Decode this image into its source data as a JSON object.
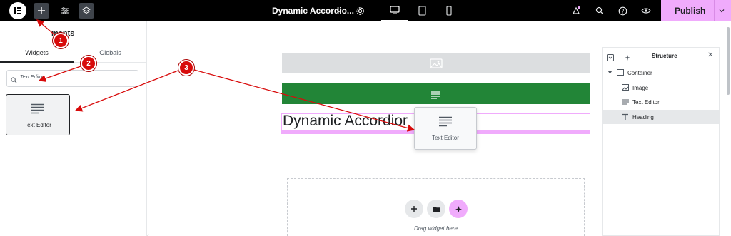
{
  "topbar": {
    "document_title": "Dynamic Accordio...",
    "publish_label": "Publish",
    "icons": [
      "elementor-logo-icon",
      "add-icon",
      "settings-sliders-icon",
      "layers-icon",
      "chevron-down-icon",
      "gear-icon",
      "desktop-icon",
      "tablet-icon",
      "mobile-icon",
      "notifications-icon",
      "search-icon",
      "help-icon",
      "preview-eye-icon",
      "chevron-down-icon"
    ]
  },
  "left_panel": {
    "title": "ments",
    "tabs": [
      "Widgets",
      "Globals"
    ],
    "search_value": "Text Editor",
    "widget_label": "Text Editor"
  },
  "canvas": {
    "heading_text": "Dynamic Accordior",
    "drag_label": "Text Editor",
    "drop_text": "Drag widget here"
  },
  "structure": {
    "title": "Structure",
    "items": [
      {
        "label": "Container",
        "icon": "container-icon"
      },
      {
        "label": "Image",
        "icon": "image-icon"
      },
      {
        "label": "Text Editor",
        "icon": "text-lines-icon"
      },
      {
        "label": "Heading",
        "icon": "heading-t-icon"
      }
    ]
  },
  "annotations": [
    "1",
    "2",
    "3"
  ],
  "colors": {
    "accent_pink": "#f0abfc",
    "annotation_red": "#d80b0b",
    "green_block": "#228537"
  }
}
